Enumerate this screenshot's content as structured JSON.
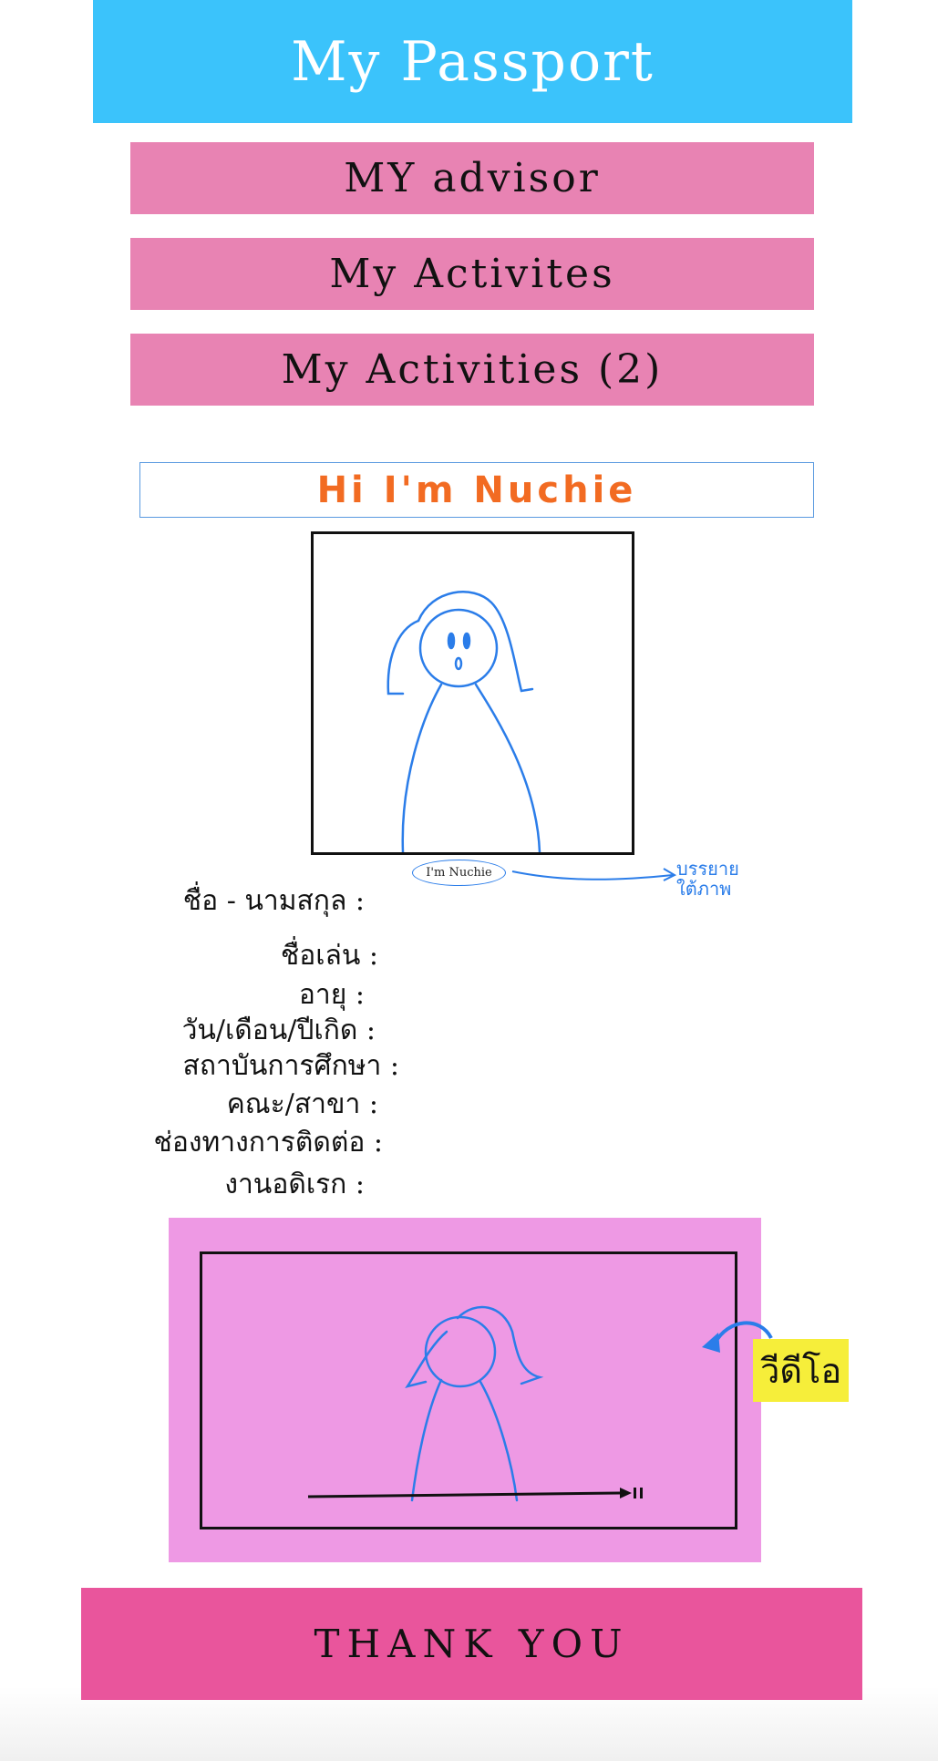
{
  "header": {
    "title": "My Passport"
  },
  "nav": [
    {
      "label": "MY advisor"
    },
    {
      "label": "My Activites"
    },
    {
      "label": "My Activities (2)"
    }
  ],
  "profile": {
    "greeting": "Hi I'm Nuchie",
    "photo_caption": "I'm Nuchie",
    "caption_note": "บรรยายใต้ภาพ",
    "fields": [
      "ชื่อ - นามสกุล :",
      "ชื่อเล่น :",
      "อายุ :",
      "วัน/เดือน/ปีเกิด :",
      "สถาบันการศึกษา :",
      "คณะ/สาขา :",
      "ช่องทางการติดต่อ :",
      "งานอดิเรก :"
    ]
  },
  "video": {
    "label": "วีดีโอ"
  },
  "footer": {
    "thanks": "THANK YOU"
  },
  "colors": {
    "header": "#3bc3fb",
    "nav": "#e883b3",
    "greeting_text": "#f26b22",
    "sketch": "#2b7de9",
    "video_bg": "#ee99e4",
    "video_label_highlight": "#f6ee3a",
    "footer": "#e9559c"
  }
}
